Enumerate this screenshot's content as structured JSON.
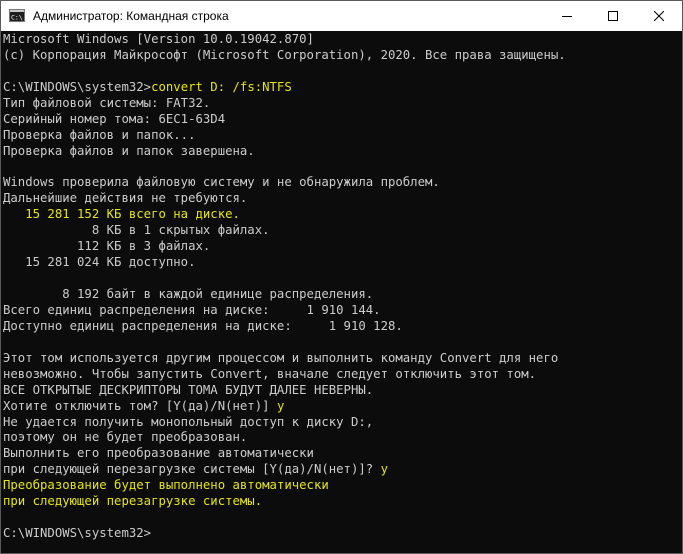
{
  "window": {
    "title": "Администратор: Командная строка",
    "icon": "cmd-icon",
    "controls": [
      "minimize-icon",
      "maximize-icon",
      "close-icon"
    ]
  },
  "colors": {
    "background": "#0c0c0c",
    "text": "#cccccc",
    "highlight": "#e5e510",
    "titlebar": "#ffffff"
  },
  "console": {
    "lines": [
      {
        "text": "Microsoft Windows [Version 10.0.19042.870]"
      },
      {
        "text": "(c) Корпорация Майкрософт (Microsoft Corporation), 2020. Все права защищены."
      },
      {
        "text": ""
      },
      {
        "text": "C:\\WINDOWS\\system32>",
        "highlight": "convert D: /fs:NTFS"
      },
      {
        "text": "Тип файловой системы: FAT32."
      },
      {
        "text": "Серийный номер тома: 6EC1-63D4"
      },
      {
        "text": "Проверка файлов и папок..."
      },
      {
        "text": "Проверка файлов и папок завершена."
      },
      {
        "text": ""
      },
      {
        "text": "Windows проверила файловую систему и не обнаружила проблем."
      },
      {
        "text": "Дальнейшие действия не требуются."
      },
      {
        "text": "",
        "highlight": "   15 281 152 КБ всего на диске."
      },
      {
        "text": "            8 КБ в 1 скрытых файлах."
      },
      {
        "text": "          112 КБ в 3 файлах."
      },
      {
        "text": "   15 281 024 КБ доступно."
      },
      {
        "text": ""
      },
      {
        "text": "        8 192 байт в каждой единице распределения."
      },
      {
        "text": "Всего единиц распределения на диске:     1 910 144."
      },
      {
        "text": "Доступно единиц распределения на диске:     1 910 128."
      },
      {
        "text": ""
      },
      {
        "text": "Этот том используется другим процессом и выполнить команду Convert для него"
      },
      {
        "text": "невозможно. Чтобы запустить Convert, вначале следует отключить этот том."
      },
      {
        "text": "ВСЕ ОТКРЫТЫЕ ДЕСКРИПТОРЫ ТОМА БУДУТ ДАЛЕЕ НЕВЕРНЫ."
      },
      {
        "text": "Хотите отключить том? [Y(да)/N(нет)] ",
        "highlight": "y"
      },
      {
        "text": "Не удается получить монопольный доступ к диску D:,"
      },
      {
        "text": "поэтому он не будет преобразован."
      },
      {
        "text": "Выполнить его преобразование автоматически"
      },
      {
        "text": "при следующей перезагрузке системы [Y(да)/N(нет)]? ",
        "highlight": "y"
      },
      {
        "text": "",
        "highlight": "Преобразование будет выполнено автоматически"
      },
      {
        "text": "",
        "highlight": "при следующей перезагрузке системы."
      },
      {
        "text": ""
      },
      {
        "text": "C:\\WINDOWS\\system32>"
      }
    ]
  }
}
